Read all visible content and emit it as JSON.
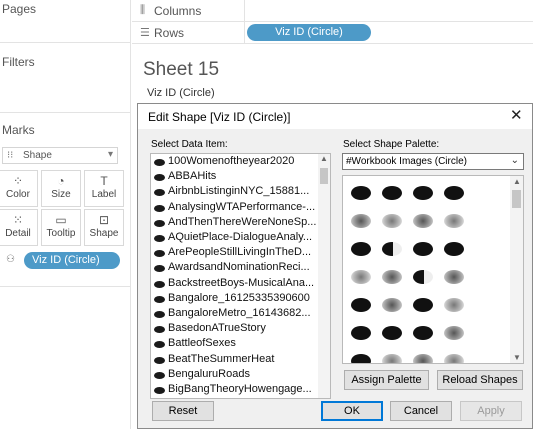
{
  "left_pane": {
    "pages_title": "Pages",
    "filters_title": "Filters",
    "marks_title": "Marks",
    "mark_type": "Shape",
    "mark_buttons": [
      {
        "label": "Color",
        "glyph": "⁘",
        "icon": "color-icon"
      },
      {
        "label": "Size",
        "glyph": "◔",
        "icon": "size-icon"
      },
      {
        "label": "Label",
        "glyph": "T",
        "icon": "label-icon"
      },
      {
        "label": "Detail",
        "glyph": "⁙",
        "icon": "detail-icon"
      },
      {
        "label": "Tooltip",
        "glyph": "▭",
        "icon": "tooltip-icon"
      },
      {
        "label": "Shape",
        "glyph": "⊡",
        "icon": "shape-icon"
      }
    ],
    "shape_pill": "Viz ID (Circle)"
  },
  "shelves": {
    "columns_label": "Columns",
    "rows_label": "Rows",
    "rows_pill": "Viz ID (Circle)"
  },
  "sheet": {
    "title": "Sheet 15",
    "subtitle": "Viz ID (Circle)"
  },
  "dialog": {
    "title": "Edit Shape [Viz ID (Circle)]",
    "select_data_item_label": "Select Data Item:",
    "select_palette_label": "Select Shape Palette:",
    "palette_value": "#Workbook Images (Circle)",
    "data_items": [
      "100Womenoftheyear2020",
      "ABBAHits",
      "AirbnbListinginNYC_15881...",
      "AnalysingWTAPerformance-...",
      "AndThenThereWereNoneSp...",
      "AQuietPlace-DialogueAnaly...",
      "ArePeopleStillLivingInTheD...",
      "AwardsandNominationReci...",
      "BackstreetBoys-MusicalAna...",
      "Bangalore_16125335390600",
      "BangaloreMetro_16143682...",
      "BasedonATrueStory",
      "BattleofSexes",
      "BeatTheSummerHeat",
      "BengaluruRoads",
      "BigBangTheoryHowengage..."
    ],
    "buttons": {
      "assign_palette": "Assign Palette",
      "reload_shapes": "Reload Shapes",
      "reset": "Reset",
      "ok": "OK",
      "cancel": "Cancel",
      "apply": "Apply"
    },
    "close_glyph": "✕"
  },
  "colors": {
    "pill": "#4d9ac8",
    "dialog_bg": "#f0f0f0",
    "focus": "#0078d7"
  }
}
